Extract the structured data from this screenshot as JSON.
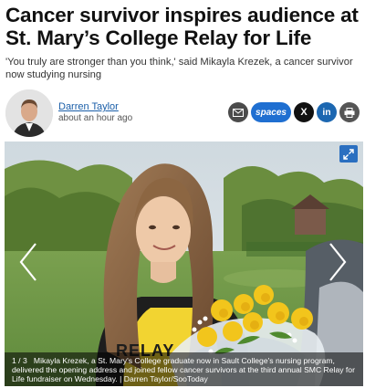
{
  "article": {
    "headline": "Cancer survivor inspires audience at St. Mary’s College Relay for Life",
    "subheadline": "'You truly are stronger than you think,' said Mikayla Krezek, a cancer survivor now studying nursing"
  },
  "byline": {
    "author": "Darren Taylor",
    "time": "about an hour ago"
  },
  "share": {
    "spaces_label": "spaces",
    "x_label": "X",
    "linkedin_label": "in"
  },
  "gallery": {
    "counter": "1 / 3",
    "caption": "Mikayla Krezek, a St. Mary's College graduate now in Sault College's nursing program, delivered the opening address and joined fellow cancer survivors at the third annual SMC Relay for Life fundraiser on Wednesday.",
    "credit": "| Darren Taylor/SooToday",
    "shirt_text": "RELAY"
  },
  "colors": {
    "link": "#1a5ea8",
    "spaces": "#1f6fd1",
    "linkedin": "#1c67b1",
    "expand": "#2a6fc0"
  }
}
